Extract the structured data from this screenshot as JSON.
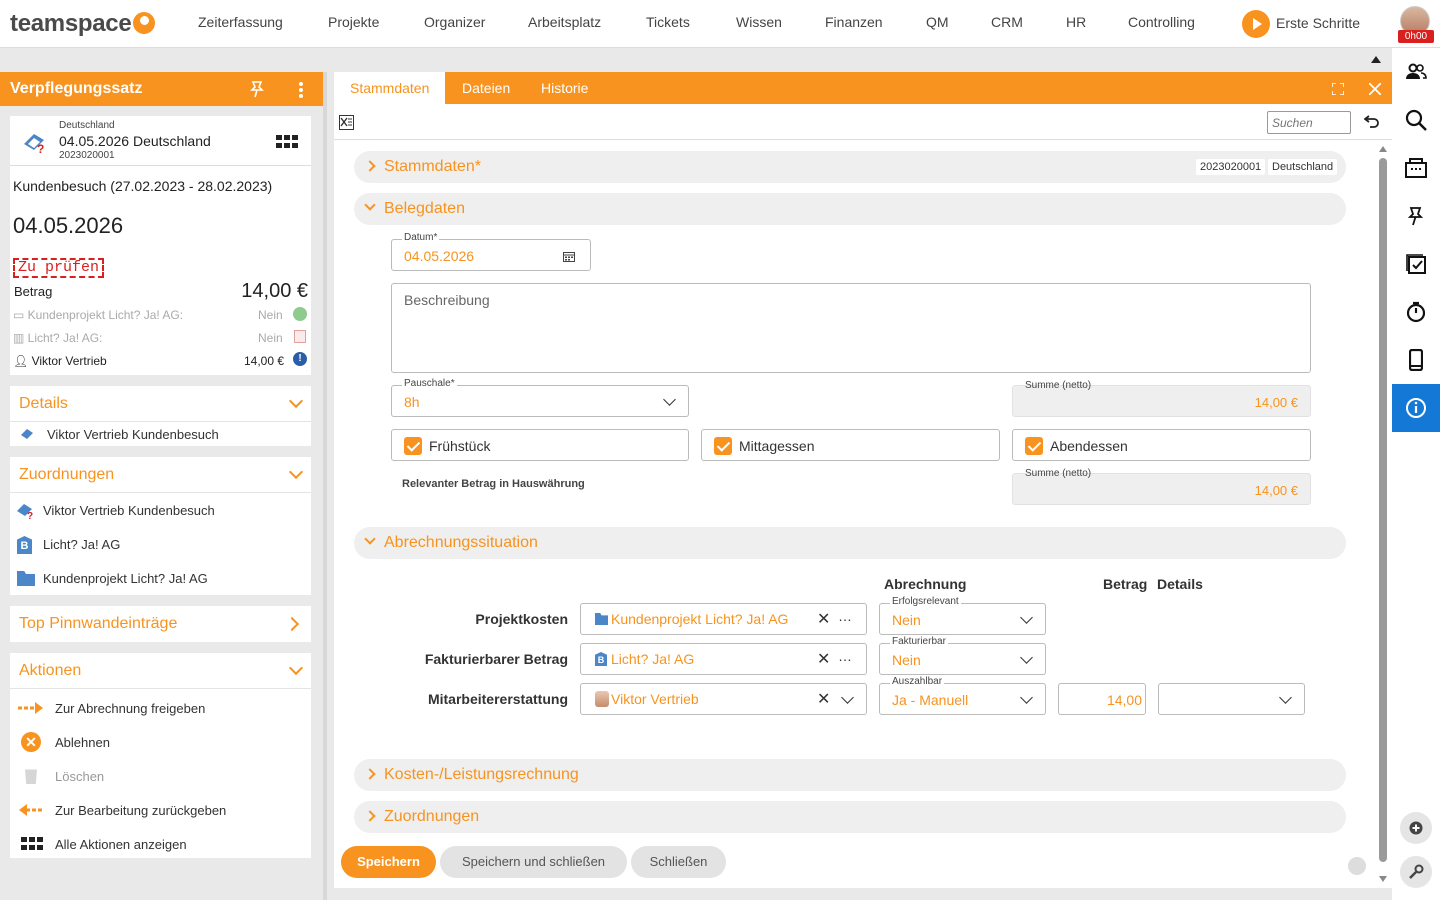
{
  "app": {
    "logo": "teamspace"
  },
  "nav": [
    "Zeiterfassung",
    "Projekte",
    "Organizer",
    "Arbeitsplatz",
    "Tickets",
    "Wissen",
    "Finanzen",
    "QM",
    "CRM",
    "HR",
    "Controlling"
  ],
  "erste_schritte": "Erste Schritte",
  "time_badge": "0h00",
  "left": {
    "title": "Verpflegungssatz",
    "record": {
      "country_small": "Deutschland",
      "title": "04.05.2026 Deutschland",
      "number": "2023020001"
    },
    "trip": "Kundenbesuch (27.02.2023 - 28.02.2023)",
    "date": "04.05.2026",
    "status": "Zu prüfen",
    "betrag_label": "Betrag",
    "betrag_value": "14,00 €",
    "lines": [
      {
        "label": "Kundenprojekt Licht? Ja! AG:",
        "value": "Nein"
      },
      {
        "label": "Licht? Ja! AG:",
        "value": "Nein"
      },
      {
        "label": "Viktor Vertrieb",
        "value": "14,00 €"
      }
    ],
    "details": {
      "title": "Details",
      "item": "Viktor Vertrieb Kundenbesuch"
    },
    "zuordnungen": {
      "title": "Zuordnungen",
      "items": [
        "Viktor Vertrieb Kundenbesuch",
        "Licht? Ja! AG",
        "Kundenprojekt Licht? Ja! AG"
      ]
    },
    "pinnwand": {
      "title": "Top Pinnwandeinträge"
    },
    "aktionen": {
      "title": "Aktionen",
      "items": [
        "Zur Abrechnung freigeben",
        "Ablehnen",
        "Löschen",
        "Zur Bearbeitung zurückgeben",
        "Alle Aktionen anzeigen"
      ]
    }
  },
  "tabs": [
    "Stammdaten",
    "Dateien",
    "Historie"
  ],
  "search_placeholder": "Suchen",
  "sections": {
    "stammdaten": "Stammdaten*",
    "stammdaten_chips": [
      "2023020001",
      "Deutschland"
    ],
    "belegdaten": "Belegdaten",
    "abrechnung": "Abrechnungssituation",
    "kosten": "Kosten-/Leistungsrechnung",
    "zuordnungen": "Zuordnungen"
  },
  "beleg": {
    "datum_label": "Datum*",
    "datum": "04.05.2026",
    "beschreibung": "Beschreibung",
    "pauschale_label": "Pauschale*",
    "pauschale": "8h",
    "summe_label": "Summe (netto)",
    "summe": "14,00 €",
    "meals": [
      "Frühstück",
      "Mittagessen",
      "Abendessen"
    ],
    "relevanter": "Relevanter Betrag in Hauswährung",
    "summe2_label": "Summe (netto)",
    "summe2": "14,00 €"
  },
  "abrechnung": {
    "col_abrechnung": "Abrechnung",
    "col_betrag": "Betrag",
    "col_details": "Details",
    "rows": [
      {
        "label": "Projektkosten",
        "ref": "Kundenprojekt Licht? Ja! AG",
        "sel_label": "Erfolgsrelevant",
        "sel": "Nein"
      },
      {
        "label": "Fakturierbarer Betrag",
        "ref": "Licht? Ja! AG",
        "sel_label": "Fakturierbar",
        "sel": "Nein"
      },
      {
        "label": "Mitarbeitererstattung",
        "ref": "Viktor Vertrieb",
        "sel_label": "Auszahlbar",
        "sel": "Ja - Manuell",
        "betrag": "14,00"
      }
    ]
  },
  "buttons": {
    "save": "Speichern",
    "save_close": "Speichern und schließen",
    "close": "Schließen"
  },
  "colors": {
    "accent": "#f7931e",
    "active_blue": "#1479d6"
  }
}
